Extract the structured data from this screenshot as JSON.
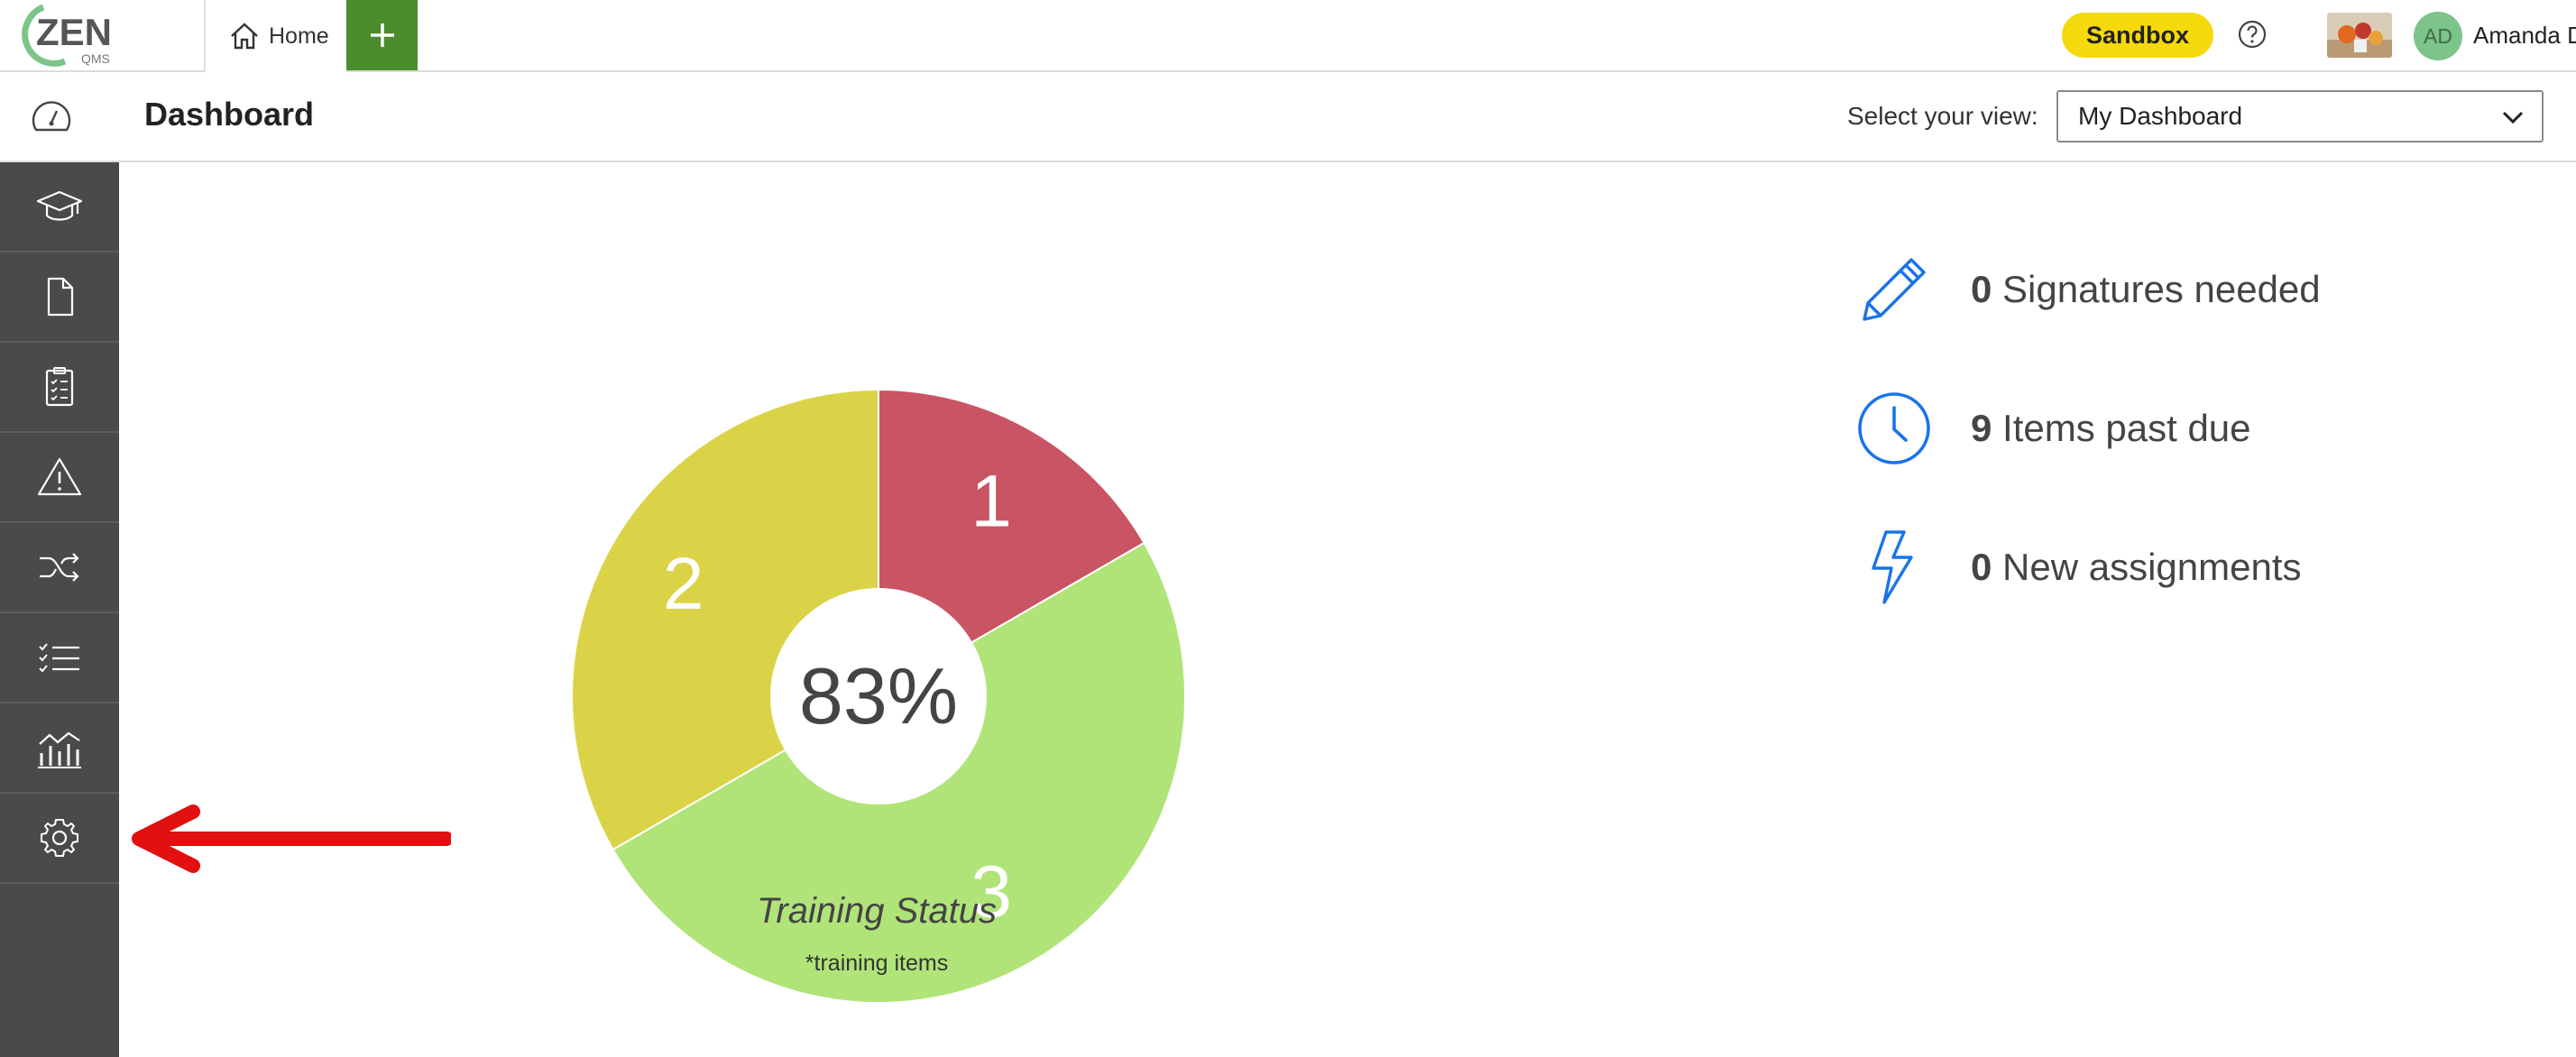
{
  "brand": {
    "logo_text": "ZEN",
    "logo_sub": "QMS",
    "accent": "#4b8c2c"
  },
  "topbar": {
    "home_tab_label": "Home",
    "add_tab_label": "+",
    "environment_badge": "Sandbox",
    "help_icon": "question-circle-icon",
    "user": {
      "initials": "AD",
      "name": "Amanda D"
    }
  },
  "header": {
    "title": "Dashboard",
    "view_label": "Select your view:",
    "view_selected": "My Dashboard"
  },
  "sidebar": {
    "items": [
      {
        "name": "training",
        "icon": "graduation-cap-icon"
      },
      {
        "name": "documents",
        "icon": "document-icon"
      },
      {
        "name": "audits",
        "icon": "clipboard-checklist-icon"
      },
      {
        "name": "risks",
        "icon": "warning-triangle-icon"
      },
      {
        "name": "workflows",
        "icon": "shuffle-icon"
      },
      {
        "name": "tasks",
        "icon": "checklist-icon"
      },
      {
        "name": "reports",
        "icon": "chart-icon"
      },
      {
        "name": "settings",
        "icon": "gear-icon"
      }
    ]
  },
  "chart_data": {
    "type": "pie",
    "donut": true,
    "center_label": "83%",
    "slices": [
      {
        "label": "1",
        "value": 1,
        "color": "#c95463"
      },
      {
        "label": "3",
        "value": 3,
        "color": "#b0e479"
      },
      {
        "label": "2",
        "value": 2,
        "color": "#dbd347"
      }
    ],
    "title": "Training Status",
    "subtitle": "*training items"
  },
  "stats": [
    {
      "icon": "pencil-icon",
      "count": "0",
      "label": "Signatures needed"
    },
    {
      "icon": "clock-icon",
      "count": "9",
      "label": "Items past due"
    },
    {
      "icon": "lightning-icon",
      "count": "0",
      "label": "New assignments"
    }
  ],
  "colors": {
    "icon_blue": "#1a73e8",
    "sidebar_bg": "#4a4a4a",
    "arrow_red": "#e21010"
  }
}
